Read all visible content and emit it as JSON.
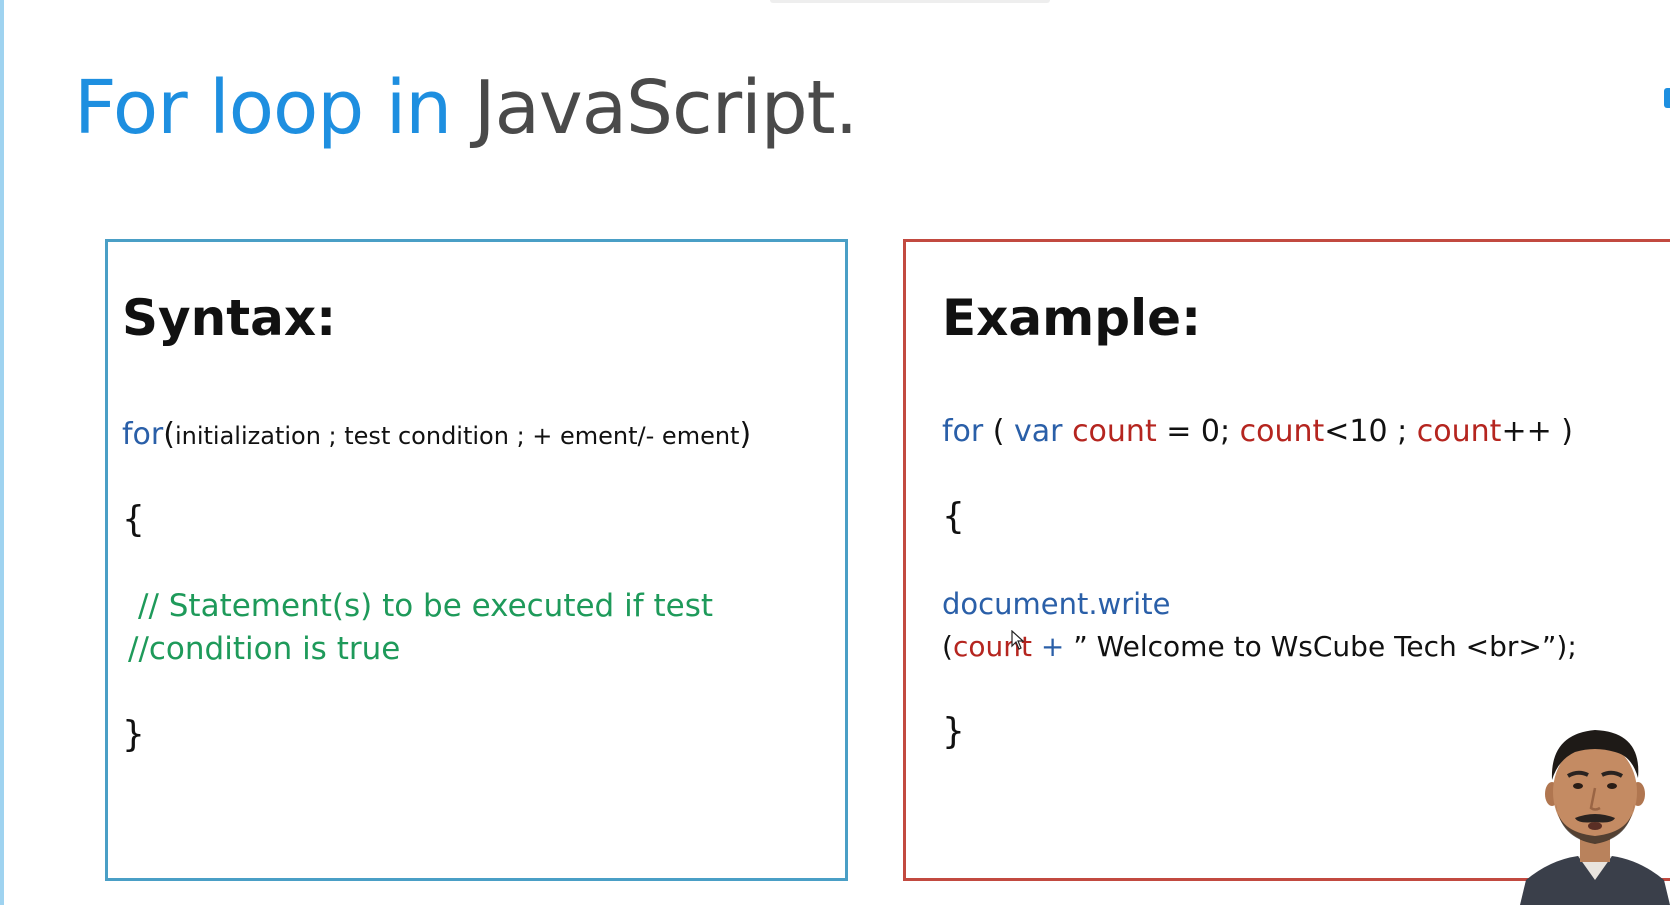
{
  "slide": {
    "title_part1": "For loop in",
    "title_part2": "JavaScript."
  },
  "syntax_panel": {
    "heading": "Syntax:",
    "line1_keyword": "for",
    "line1_open": "(",
    "line1_params": "initialization ; test condition ; + ement/- ement",
    "line1_close": ")",
    "open_brace": "{",
    "comment_line1": "// Statement(s) to be executed if test",
    "comment_line2": "//condition is true",
    "close_brace": "}"
  },
  "example_panel": {
    "heading": "Example:",
    "tok_for": "for",
    "tok_paren_open": " ( ",
    "tok_var": "var",
    "tok_space": " ",
    "tok_count1": "count",
    "tok_assign": " = 0;  ",
    "tok_count2": "count",
    "tok_cond": "<10 ; ",
    "tok_count3": "count",
    "tok_incr": "++ )",
    "open_brace": "{",
    "call_line": "document.write",
    "arg_open": "(",
    "arg_count": "count",
    "arg_plus": " + ",
    "arg_string": "” Welcome to WsCube Tech <br>”);",
    "close_brace": "}"
  },
  "colors": {
    "title_blue": "#1e8fe0",
    "title_gray": "#4a4a4a",
    "syntax_border": "#4a9fc6",
    "example_border": "#c24a40",
    "keyword_blue": "#2a5fa8",
    "comment_green": "#1e9a5a",
    "variable_red": "#b5251f"
  },
  "icons": {
    "cursor": "mouse-pointer-icon",
    "presenter": "presenter-webcam-icon"
  }
}
